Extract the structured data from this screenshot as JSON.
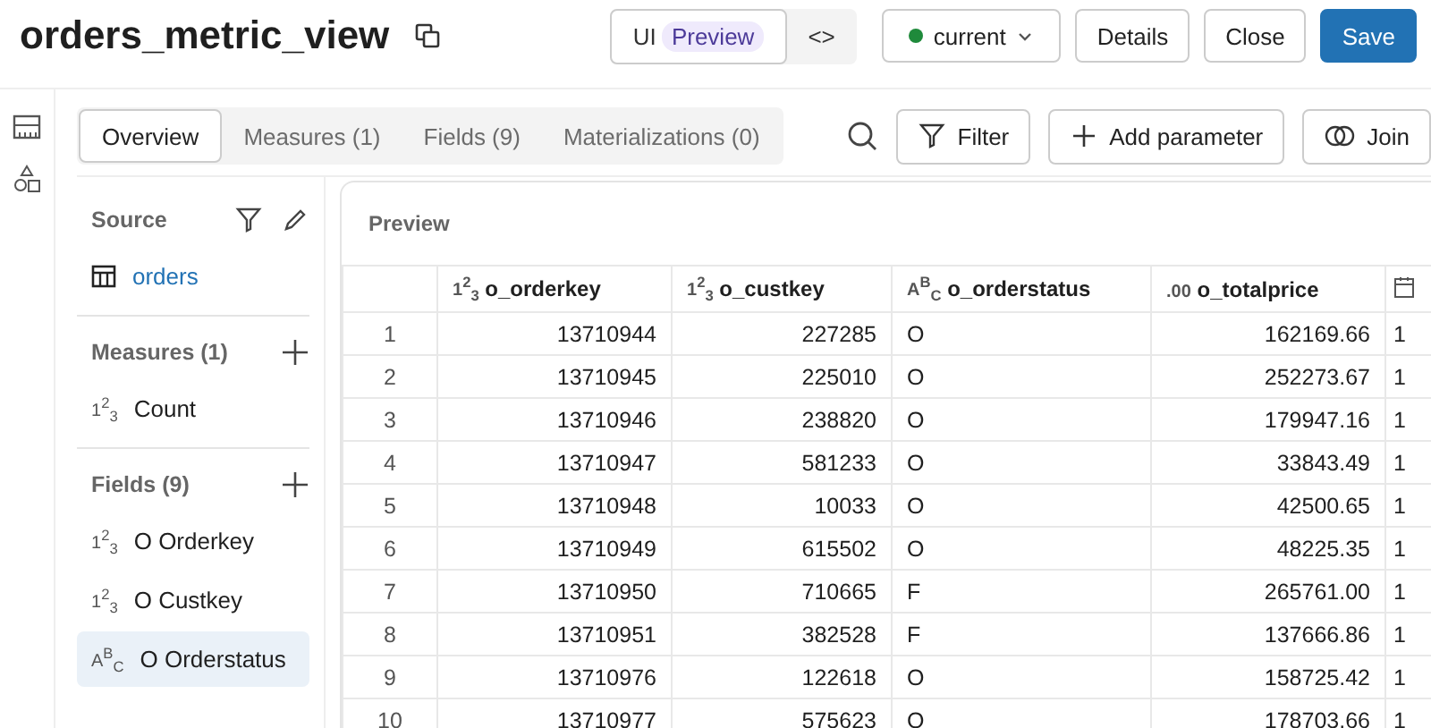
{
  "title": "orders_metric_view",
  "mode_toggle": {
    "ui_label": "UI",
    "badge": "Preview",
    "code_label": "<>"
  },
  "version": {
    "label": "current",
    "color": "#1f8a3b"
  },
  "buttons": [
    {
      "label": "Details",
      "kind": "secondary"
    },
    {
      "label": "Close",
      "kind": "secondary"
    },
    {
      "label": "Save",
      "kind": "primary"
    }
  ],
  "tabs": [
    {
      "label": "Overview",
      "selected": true
    },
    {
      "label": "Measures (1)",
      "selected": false
    },
    {
      "label": "Fields (9)",
      "selected": false
    },
    {
      "label": "Materializations (0)",
      "selected": false
    }
  ],
  "toolbar": [
    {
      "label": "Filter",
      "kind": "filter"
    },
    {
      "label": "Add parameter",
      "kind": "add"
    },
    {
      "label": "Join",
      "kind": "join"
    }
  ],
  "sidebar": {
    "source_heading": "Source",
    "source": "orders",
    "measures_heading": "Measures (1)",
    "measures": [
      {
        "type": "1$^{2}$$_{3}$",
        "label": "Count",
        "selected": false
      }
    ],
    "fields_heading": "Fields (9)",
    "fields": [
      {
        "type": "1$^{2}$$_{3}$",
        "label": "O Orderkey",
        "selected": false
      },
      {
        "type": "1$^{2}$$_{3}$",
        "label": "O Custkey",
        "selected": false
      },
      {
        "type": "A$^{B}$$_{C}$",
        "label": "O Orderstatus",
        "selected": true
      }
    ]
  },
  "preview": {
    "title": "Preview",
    "columns": [
      {
        "type": "1$^{2}$$_{3}$",
        "label": "o_orderkey",
        "kind": "number"
      },
      {
        "type": "1$^{2}$$_{3}$",
        "label": "o_custkey",
        "kind": "number"
      },
      {
        "type": "A$^{B}$$_{C}$",
        "label": "o_orderstatus",
        "kind": "text"
      },
      {
        "type": ".00",
        "label": "o_totalprice",
        "kind": "number"
      },
      {
        "kind": "date"
      }
    ],
    "rows": [
      {
        "number": "1",
        "cells": [
          "13710944",
          "227285",
          "O",
          "162169.66",
          "1"
        ]
      },
      {
        "number": "2",
        "cells": [
          "13710945",
          "225010",
          "O",
          "252273.67",
          "1"
        ]
      },
      {
        "number": "3",
        "cells": [
          "13710946",
          "238820",
          "O",
          "179947.16",
          "1"
        ]
      },
      {
        "number": "4",
        "cells": [
          "13710947",
          "581233",
          "O",
          "33843.49",
          "1"
        ]
      },
      {
        "number": "5",
        "cells": [
          "13710948",
          "10033",
          "O",
          "42500.65",
          "1"
        ]
      },
      {
        "number": "6",
        "cells": [
          "13710949",
          "615502",
          "O",
          "48225.35",
          "1"
        ]
      },
      {
        "number": "7",
        "cells": [
          "13710950",
          "710665",
          "F",
          "265761.00",
          "1"
        ]
      },
      {
        "number": "8",
        "cells": [
          "13710951",
          "382528",
          "F",
          "137666.86",
          "1"
        ]
      },
      {
        "number": "9",
        "cells": [
          "13710976",
          "122618",
          "O",
          "158725.42",
          "1"
        ]
      },
      {
        "number": "10",
        "cells": [
          "13710977",
          "575623",
          "O",
          "178703.66",
          "1"
        ]
      }
    ]
  }
}
